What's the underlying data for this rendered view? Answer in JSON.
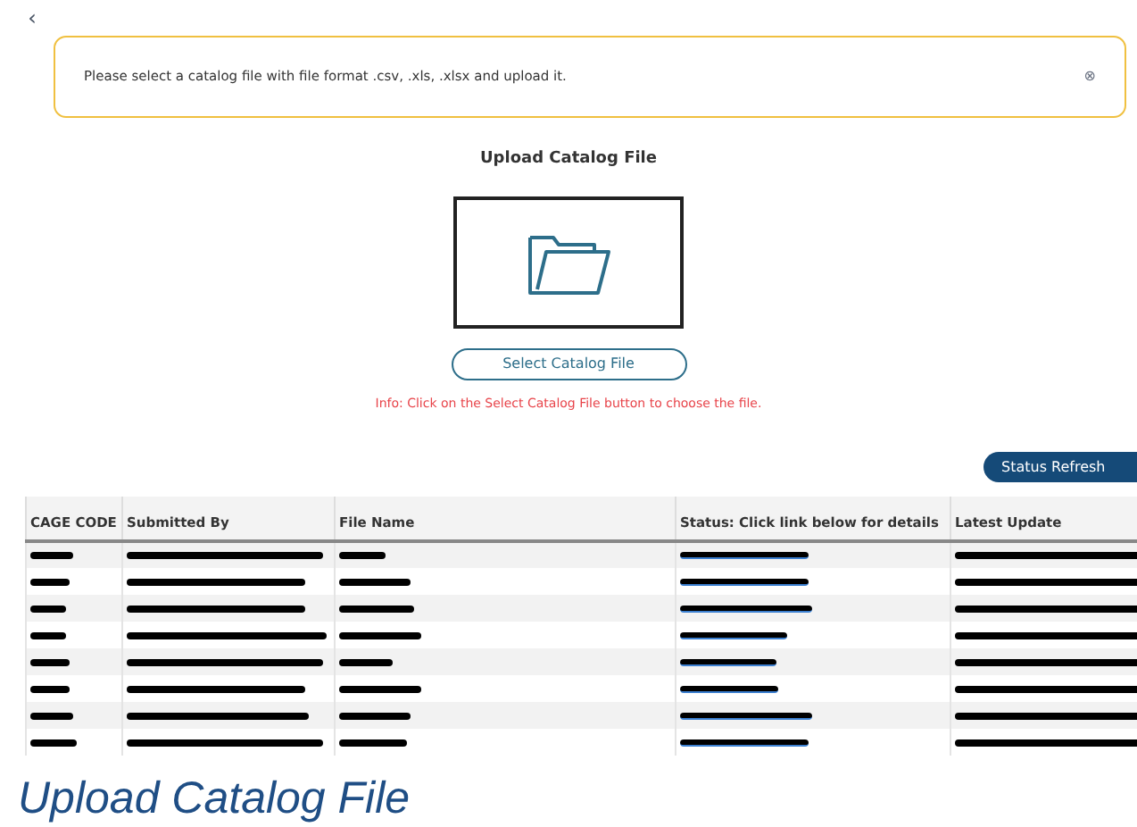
{
  "back_button": {
    "label": "‹"
  },
  "alert": {
    "message": "Please select a catalog file with file format .csv, .xls, .xlsx and upload it.",
    "close": "⊗"
  },
  "upload": {
    "title": "Upload Catalog File",
    "button": "Select Catalog File",
    "info": "Info: Click on the Select Catalog File button to choose the file."
  },
  "status_refresh": {
    "label": "Status Refresh"
  },
  "table": {
    "columns": [
      "CAGE CODE",
      "Submitted By",
      "File Name",
      "Status: Click link below for details",
      "Latest Update"
    ],
    "rows": [
      {
        "redacted": true
      },
      {
        "redacted": true
      },
      {
        "redacted": true
      },
      {
        "redacted": true
      },
      {
        "redacted": true
      },
      {
        "redacted": true
      },
      {
        "redacted": true
      },
      {
        "redacted": true
      }
    ]
  },
  "caption": "Upload Catalog File"
}
